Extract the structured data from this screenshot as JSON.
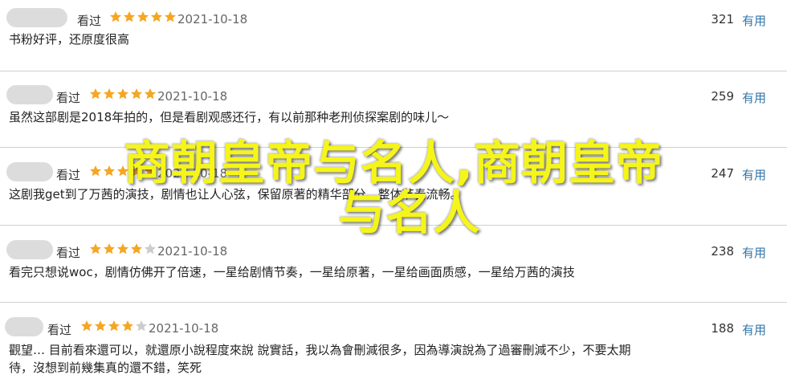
{
  "colors": {
    "star": "#f5a623",
    "star_empty": "#cccccc",
    "link": "#3377aa",
    "overlay": "#f5f51a"
  },
  "icons": {
    "star": "star-icon"
  },
  "reviews": [
    {
      "status": "看过",
      "rating": 5,
      "date": "2021-10-18",
      "useful_count": "321",
      "useful_label": "有用",
      "lines": [
        "书粉好评，还原度很高"
      ]
    },
    {
      "status": "看过",
      "rating": 5,
      "date": "2021-10-18",
      "useful_count": "259",
      "useful_label": "有用",
      "lines": [
        "虽然这部剧是2018年拍的，但是看剧观感还行，有以前那种老刑侦探案剧的味儿～"
      ]
    },
    {
      "status": "看过",
      "rating": 5,
      "date": "2021-10-18",
      "useful_count": "247",
      "useful_label": "有用",
      "lines": [
        "这剧我get到了万茜的演技，剧情也让人心弦，保留原著的精华部分，整体节奏流畅。"
      ]
    },
    {
      "status": "看过",
      "rating": 4,
      "date": "2021-10-18",
      "useful_count": "238",
      "useful_label": "有用",
      "lines": [
        "看完只想说woc，剧情仿佛开了倍速，一星给剧情节奏，一星给原著，一星给画面质感，一星给万茜的演技"
      ]
    },
    {
      "status": "看过",
      "rating": 4,
      "date": "2021-10-18",
      "useful_count": "188",
      "useful_label": "有用",
      "lines": [
        "觀望… 目前看來還可以，就還原小說程度來說 說實話，我以為會刪減很多，因為導演說為了過審刪減不少，不要太期",
        "待，沒想到前幾集真的還不錯，笑死"
      ]
    }
  ],
  "overlay": {
    "line1": "商朝皇帝与名人,商朝皇帝",
    "line2": "与名人"
  }
}
